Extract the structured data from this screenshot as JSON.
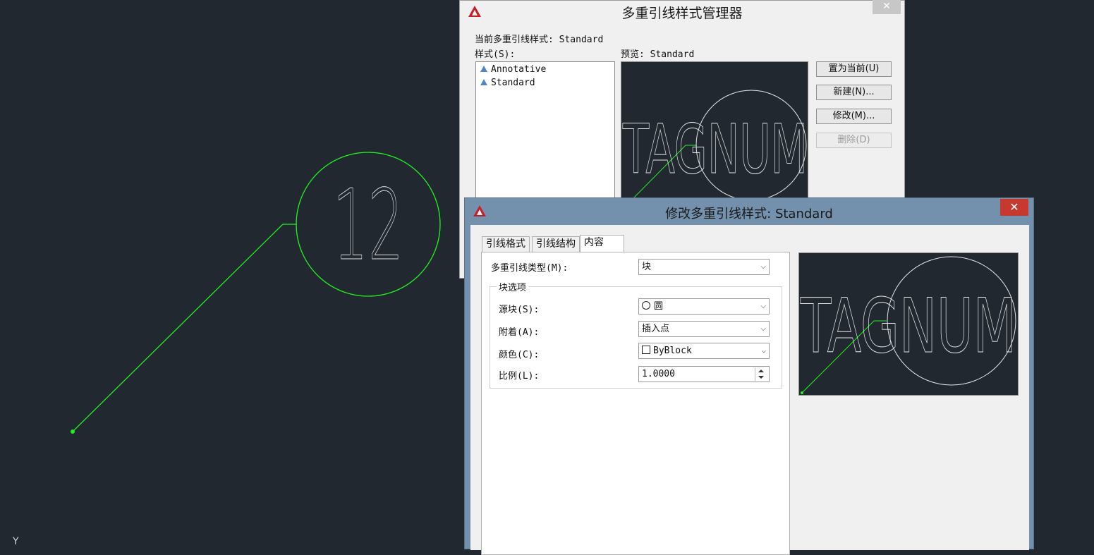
{
  "canvas": {
    "balloon_text": "12",
    "ucs_axis": "Y"
  },
  "manager_dialog": {
    "title": "多重引线样式管理器",
    "close_glyph": "✕",
    "current_style_label": "当前多重引线样式: Standard",
    "styles_label": "样式(S):",
    "styles": [
      "Annotative",
      "Standard"
    ],
    "preview_label": "预览: Standard",
    "preview_text": "TAGNUM",
    "buttons": {
      "set_current": "置为当前(U)",
      "new": "新建(N)...",
      "modify": "修改(M)...",
      "delete": "删除(D)"
    }
  },
  "modify_dialog": {
    "title": "修改多重引线样式: Standard",
    "close_glyph": "✕",
    "tabs": [
      "引线格式",
      "引线结构",
      "内容"
    ],
    "active_tab": "内容",
    "multileader_type_label": "多重引线类型(M):",
    "multileader_type_value": "块",
    "block_options_title": "块选项",
    "source_block_label": "源块(S):",
    "source_block_value": "圆",
    "attachment_label": "附着(A):",
    "attachment_value": "插入点",
    "color_label": "颜色(C):",
    "color_value": "ByBlock",
    "scale_label": "比例(L):",
    "scale_value": "1.0000",
    "preview_text": "TAGNUM"
  },
  "colors": {
    "canvas_bg": "#212830",
    "leader_green": "#22ee22",
    "preview_line": "#e6e6e6"
  }
}
